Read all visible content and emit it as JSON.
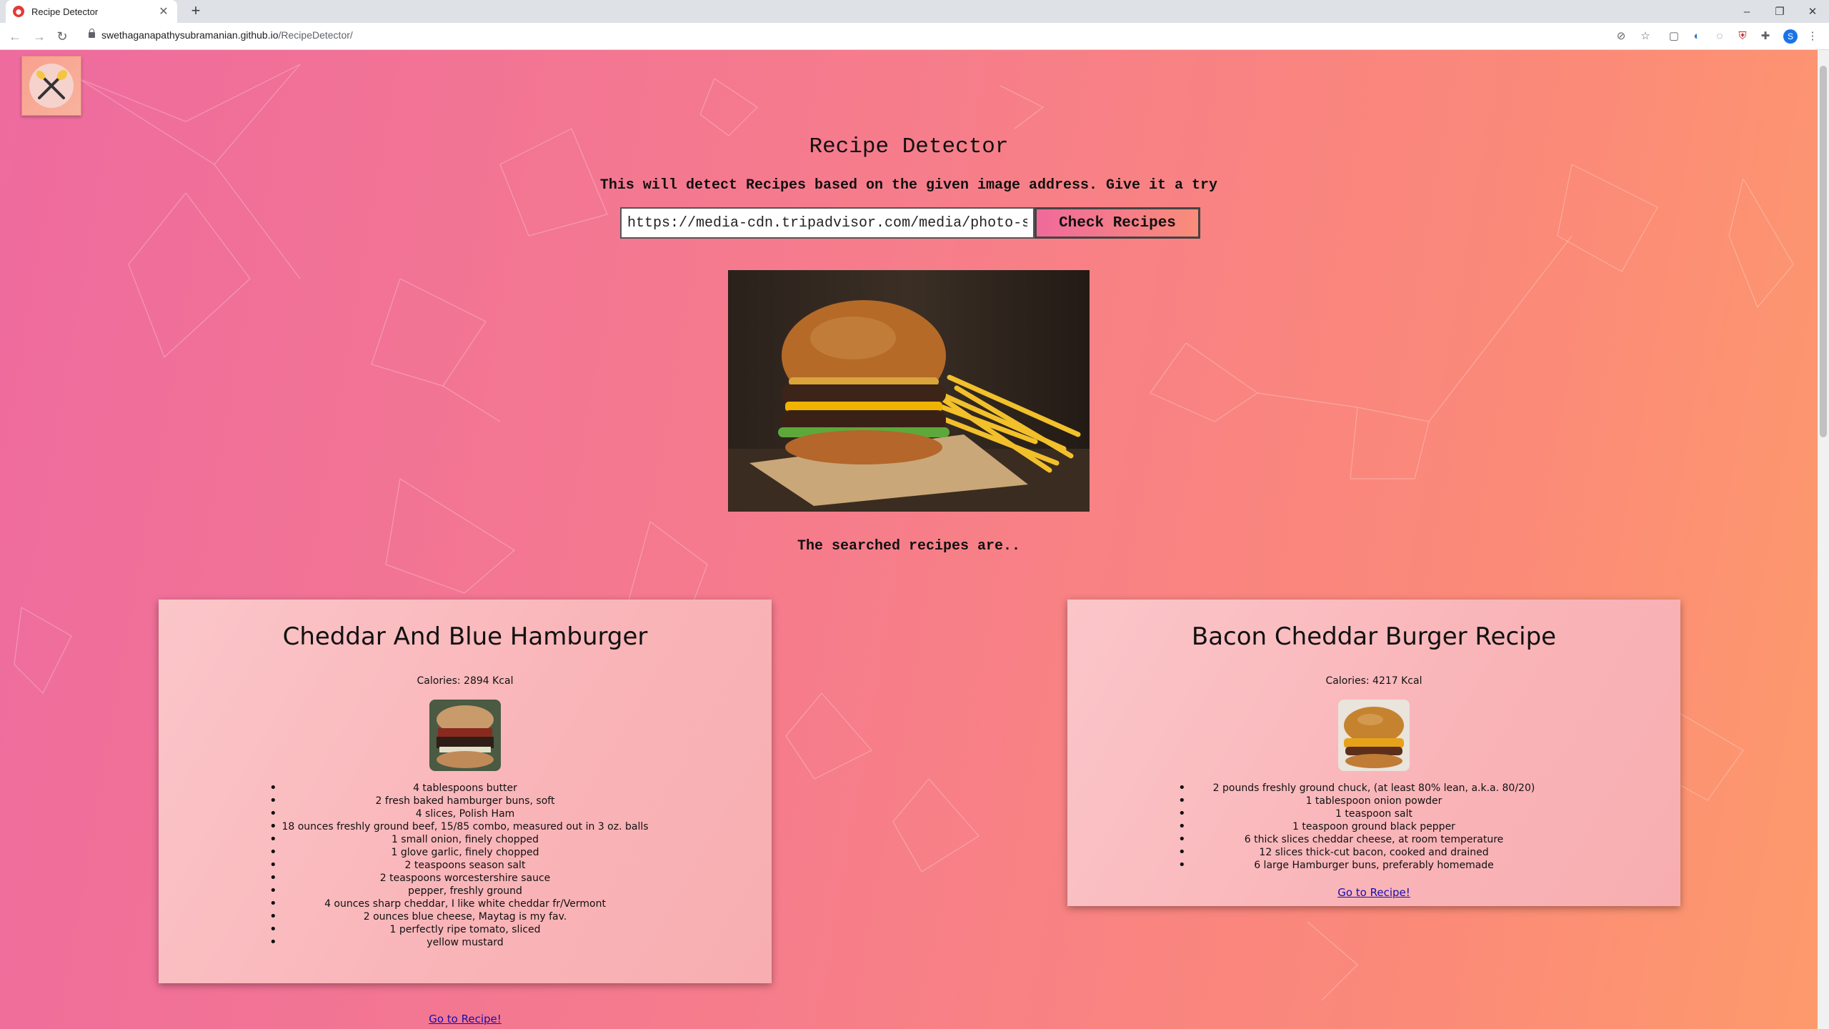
{
  "browser": {
    "tab_title": "Recipe Detector",
    "url_host": "swethaganapathysubramanian.github.io",
    "url_path": "/RecipeDetector/",
    "profile_initial": "S"
  },
  "page": {
    "title": "Recipe Detector",
    "subtitle": "This will detect Recipes based on the given image address. Give it a try",
    "input_value": "https://media-cdn.tripadvisor.com/media/photo-s",
    "check_button": "Check Recipes",
    "searched_label": "The searched recipes are.."
  },
  "recipes": [
    {
      "title": "Cheddar And Blue Hamburger",
      "calories": "Calories: 2894 Kcal",
      "ingredients": [
        "4 tablespoons butter",
        "2 fresh baked hamburger buns, soft",
        "4 slices, Polish Ham",
        "18 ounces freshly ground beef, 15/85 combo, measured out in 3 oz. balls",
        "1 small onion, finely chopped",
        "1 glove garlic, finely chopped",
        "2 teaspoons season salt",
        "2 teaspoons worcestershire sauce",
        "pepper, freshly ground",
        "4 ounces sharp cheddar, I like white cheddar fr/Vermont",
        "2 ounces blue cheese, Maytag is my fav.",
        "1 perfectly ripe tomato, sliced",
        "yellow mustard"
      ],
      "link": "Go to Recipe!"
    },
    {
      "title": "Bacon Cheddar Burger Recipe",
      "calories": "Calories: 4217 Kcal",
      "ingredients": [
        "2 pounds freshly ground chuck, (at least 80% lean, a.k.a. 80/20)",
        "1 tablespoon onion powder",
        "1 teaspoon salt",
        "1 teaspoon ground black pepper",
        "6 thick slices cheddar cheese, at room temperature",
        "12 slices thick-cut bacon, cooked and drained",
        "6 large Hamburger buns, preferably homemade"
      ],
      "link": "Go to Recipe!"
    }
  ]
}
